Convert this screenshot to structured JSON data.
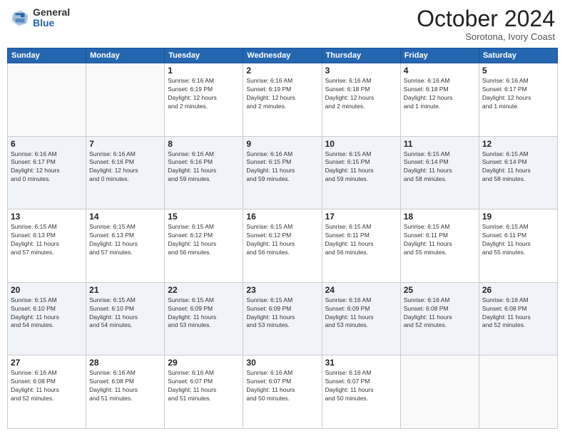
{
  "header": {
    "logo_general": "General",
    "logo_blue": "Blue",
    "month": "October 2024",
    "location": "Sorotona, Ivory Coast"
  },
  "weekdays": [
    "Sunday",
    "Monday",
    "Tuesday",
    "Wednesday",
    "Thursday",
    "Friday",
    "Saturday"
  ],
  "weeks": [
    [
      {
        "day": "",
        "info": ""
      },
      {
        "day": "",
        "info": ""
      },
      {
        "day": "1",
        "info": "Sunrise: 6:16 AM\nSunset: 6:19 PM\nDaylight: 12 hours\nand 2 minutes."
      },
      {
        "day": "2",
        "info": "Sunrise: 6:16 AM\nSunset: 6:19 PM\nDaylight: 12 hours\nand 2 minutes."
      },
      {
        "day": "3",
        "info": "Sunrise: 6:16 AM\nSunset: 6:18 PM\nDaylight: 12 hours\nand 2 minutes."
      },
      {
        "day": "4",
        "info": "Sunrise: 6:16 AM\nSunset: 6:18 PM\nDaylight: 12 hours\nand 1 minute."
      },
      {
        "day": "5",
        "info": "Sunrise: 6:16 AM\nSunset: 6:17 PM\nDaylight: 12 hours\nand 1 minute."
      }
    ],
    [
      {
        "day": "6",
        "info": "Sunrise: 6:16 AM\nSunset: 6:17 PM\nDaylight: 12 hours\nand 0 minutes."
      },
      {
        "day": "7",
        "info": "Sunrise: 6:16 AM\nSunset: 6:16 PM\nDaylight: 12 hours\nand 0 minutes."
      },
      {
        "day": "8",
        "info": "Sunrise: 6:16 AM\nSunset: 6:16 PM\nDaylight: 11 hours\nand 59 minutes."
      },
      {
        "day": "9",
        "info": "Sunrise: 6:16 AM\nSunset: 6:15 PM\nDaylight: 11 hours\nand 59 minutes."
      },
      {
        "day": "10",
        "info": "Sunrise: 6:15 AM\nSunset: 6:15 PM\nDaylight: 11 hours\nand 59 minutes."
      },
      {
        "day": "11",
        "info": "Sunrise: 6:15 AM\nSunset: 6:14 PM\nDaylight: 11 hours\nand 58 minutes."
      },
      {
        "day": "12",
        "info": "Sunrise: 6:15 AM\nSunset: 6:14 PM\nDaylight: 11 hours\nand 58 minutes."
      }
    ],
    [
      {
        "day": "13",
        "info": "Sunrise: 6:15 AM\nSunset: 6:13 PM\nDaylight: 11 hours\nand 57 minutes."
      },
      {
        "day": "14",
        "info": "Sunrise: 6:15 AM\nSunset: 6:13 PM\nDaylight: 11 hours\nand 57 minutes."
      },
      {
        "day": "15",
        "info": "Sunrise: 6:15 AM\nSunset: 6:12 PM\nDaylight: 11 hours\nand 56 minutes."
      },
      {
        "day": "16",
        "info": "Sunrise: 6:15 AM\nSunset: 6:12 PM\nDaylight: 11 hours\nand 56 minutes."
      },
      {
        "day": "17",
        "info": "Sunrise: 6:15 AM\nSunset: 6:11 PM\nDaylight: 11 hours\nand 56 minutes."
      },
      {
        "day": "18",
        "info": "Sunrise: 6:15 AM\nSunset: 6:11 PM\nDaylight: 11 hours\nand 55 minutes."
      },
      {
        "day": "19",
        "info": "Sunrise: 6:15 AM\nSunset: 6:11 PM\nDaylight: 11 hours\nand 55 minutes."
      }
    ],
    [
      {
        "day": "20",
        "info": "Sunrise: 6:15 AM\nSunset: 6:10 PM\nDaylight: 11 hours\nand 54 minutes."
      },
      {
        "day": "21",
        "info": "Sunrise: 6:15 AM\nSunset: 6:10 PM\nDaylight: 11 hours\nand 54 minutes."
      },
      {
        "day": "22",
        "info": "Sunrise: 6:15 AM\nSunset: 6:09 PM\nDaylight: 11 hours\nand 53 minutes."
      },
      {
        "day": "23",
        "info": "Sunrise: 6:15 AM\nSunset: 6:09 PM\nDaylight: 11 hours\nand 53 minutes."
      },
      {
        "day": "24",
        "info": "Sunrise: 6:16 AM\nSunset: 6:09 PM\nDaylight: 11 hours\nand 53 minutes."
      },
      {
        "day": "25",
        "info": "Sunrise: 6:16 AM\nSunset: 6:08 PM\nDaylight: 11 hours\nand 52 minutes."
      },
      {
        "day": "26",
        "info": "Sunrise: 6:16 AM\nSunset: 6:08 PM\nDaylight: 11 hours\nand 52 minutes."
      }
    ],
    [
      {
        "day": "27",
        "info": "Sunrise: 6:16 AM\nSunset: 6:08 PM\nDaylight: 11 hours\nand 52 minutes."
      },
      {
        "day": "28",
        "info": "Sunrise: 6:16 AM\nSunset: 6:08 PM\nDaylight: 11 hours\nand 51 minutes."
      },
      {
        "day": "29",
        "info": "Sunrise: 6:16 AM\nSunset: 6:07 PM\nDaylight: 11 hours\nand 51 minutes."
      },
      {
        "day": "30",
        "info": "Sunrise: 6:16 AM\nSunset: 6:07 PM\nDaylight: 11 hours\nand 50 minutes."
      },
      {
        "day": "31",
        "info": "Sunrise: 6:16 AM\nSunset: 6:07 PM\nDaylight: 11 hours\nand 50 minutes."
      },
      {
        "day": "",
        "info": ""
      },
      {
        "day": "",
        "info": ""
      }
    ]
  ]
}
